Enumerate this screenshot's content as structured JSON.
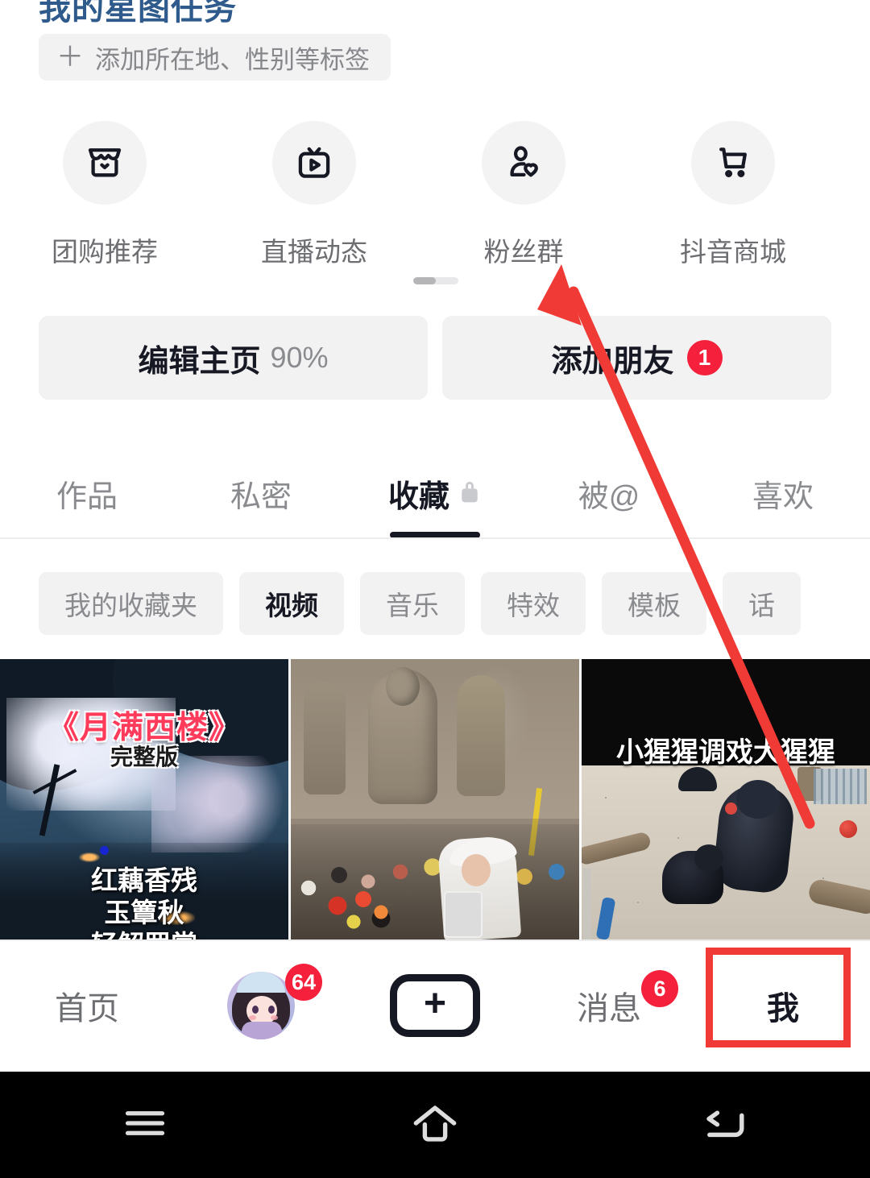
{
  "header": {
    "star_task_title": "我的星图任务",
    "tag_button": {
      "plus": "＋",
      "label": "添加所在地、性别等标签"
    }
  },
  "shortcuts": [
    {
      "label": "团购推荐",
      "icon": "storefront-icon"
    },
    {
      "label": "直播动态",
      "icon": "live-tv-icon"
    },
    {
      "label": "粉丝群",
      "icon": "fans-group-icon"
    },
    {
      "label": "抖音商城",
      "icon": "shopping-cart-icon"
    }
  ],
  "actions": {
    "edit_profile_label": "编辑主页",
    "edit_profile_percent": "90%",
    "add_friend_label": "添加朋友",
    "add_friend_badge": "1"
  },
  "tabs": [
    {
      "label": "作品",
      "active": false,
      "locked": false
    },
    {
      "label": "私密",
      "active": false,
      "locked": false
    },
    {
      "label": "收藏",
      "active": true,
      "locked": true
    },
    {
      "label": "被@",
      "active": false,
      "locked": false
    },
    {
      "label": "喜欢",
      "active": false,
      "locked": false
    }
  ],
  "chips": [
    {
      "label": "我的收藏夹",
      "active": false
    },
    {
      "label": "视频",
      "active": true
    },
    {
      "label": "音乐",
      "active": false
    },
    {
      "label": "特效",
      "active": false
    },
    {
      "label": "模板",
      "active": false
    },
    {
      "label": "话",
      "active": false
    }
  ],
  "thumbnails": [
    {
      "name": "moonlit-west-tower-video",
      "title": "《月满西楼》",
      "subtitle": "完整版",
      "lyrics": [
        "红藕香残",
        "玉簟秋",
        "轻解罗裳"
      ]
    },
    {
      "name": "longmen-grottoes-crowd-video",
      "caption": ""
    },
    {
      "name": "gorilla-video",
      "caption": "小猩猩调戏大猩猩"
    }
  ],
  "bottom_nav": [
    {
      "label": "首页",
      "badge": "",
      "selected": false,
      "type": "text"
    },
    {
      "label": "",
      "badge": "64",
      "selected": false,
      "type": "avatar"
    },
    {
      "label": "",
      "badge": "",
      "selected": false,
      "type": "plus"
    },
    {
      "label": "消息",
      "badge": "6",
      "selected": false,
      "type": "text"
    },
    {
      "label": "我",
      "badge": "",
      "selected": true,
      "type": "text"
    }
  ],
  "system_nav": [
    {
      "icon": "menu-icon"
    },
    {
      "icon": "home-icon"
    },
    {
      "icon": "back-icon"
    }
  ],
  "annotations": {
    "highlight_target": "我",
    "arrow_points_to": "粉丝群",
    "accent_color": "#ef3a35",
    "badge_color": "#f5203c"
  }
}
